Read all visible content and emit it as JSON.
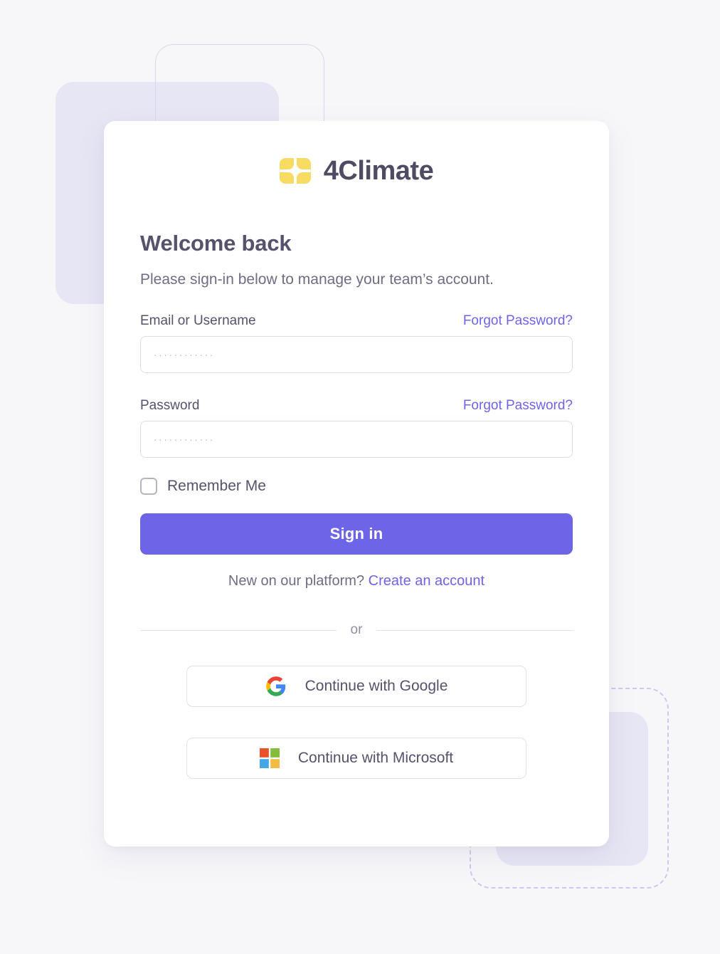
{
  "colors": {
    "page_background": "#f7f7fa",
    "card_background": "#ffffff",
    "accent_purple": "#6e64e8",
    "deco_purple": "#e7e6f4",
    "deco_dashed": "#cdc9ee",
    "logo_yellow": "#f7db62",
    "heading_text": "#55526b",
    "muted_text": "#6f6d84"
  },
  "brand": {
    "name": "4Climate",
    "logo_icon": "four-petal-flower-icon"
  },
  "heading": {
    "title": "Welcome back",
    "subtitle": "Please sign-in below to manage your team’s account."
  },
  "form": {
    "email": {
      "label": "Email or Username",
      "forgot_label": "Forgot Password?",
      "value": "",
      "placeholder": "············"
    },
    "password": {
      "label": "Password",
      "forgot_label": "Forgot Password?",
      "value": "",
      "placeholder": "············"
    },
    "remember_me": {
      "label": "Remember Me",
      "checked": false
    },
    "submit_label": "Sign in"
  },
  "signup": {
    "prompt": "New on our platform?",
    "link_label": "Create an account"
  },
  "divider": {
    "text": "or"
  },
  "social": [
    {
      "id": "google",
      "label": "Continue with Google",
      "icon": "google-icon"
    },
    {
      "id": "microsoft",
      "label": "Continue with Microsoft",
      "icon": "microsoft-icon"
    }
  ]
}
